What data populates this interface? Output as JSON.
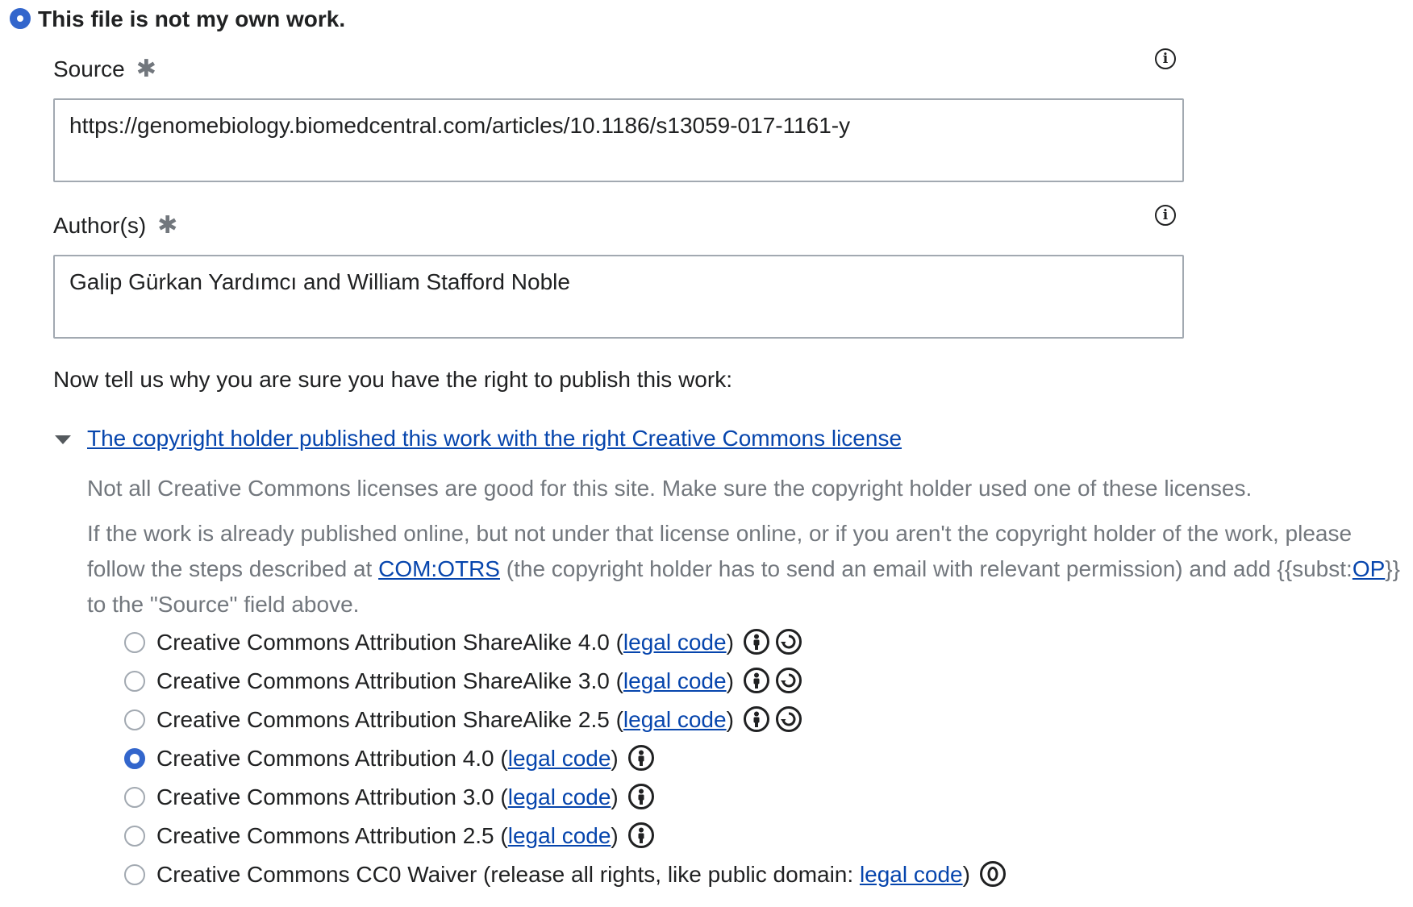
{
  "ownership": {
    "selected_option": "This file is not my own work."
  },
  "source": {
    "label": "Source",
    "required_mark": "✱",
    "value": "https://genomebiology.biomedcentral.com/articles/10.1186/s13059-017-1161-y"
  },
  "authors": {
    "label": "Author(s)",
    "required_mark": "✱",
    "value": "Galip Gürkan Yardımcı and William Stafford Noble"
  },
  "question": "Now tell us why you are sure you have the right to publish this work:",
  "license_section": {
    "expander_label": "The copyright holder published this work with the right Creative Commons license",
    "help_1": "Not all Creative Commons licenses are good for this site. Make sure the copyright holder used one of these licenses.",
    "help_2_before": "If the work is already published online, but not under that license online, or if you aren't the copyright holder of the work, please follow the steps described at ",
    "help_2_link": "COM:OTRS",
    "help_2_middle": " (the copyright holder has to send an email with relevant permission) and add {{subst:",
    "help_2_link2": "OP",
    "help_2_after": "}} to the \"Source\" field above.",
    "legal_code_label": "legal code",
    "licenses": [
      {
        "name": "Creative Commons Attribution ShareAlike 4.0 (",
        "close": ")",
        "icons": [
          "attribution-icon",
          "sharealike-icon"
        ],
        "checked": false
      },
      {
        "name": "Creative Commons Attribution ShareAlike 3.0 (",
        "close": ")",
        "icons": [
          "attribution-icon",
          "sharealike-icon"
        ],
        "checked": false
      },
      {
        "name": "Creative Commons Attribution ShareAlike 2.5 (",
        "close": ")",
        "icons": [
          "attribution-icon",
          "sharealike-icon"
        ],
        "checked": false
      },
      {
        "name": "Creative Commons Attribution 4.0 (",
        "close": ")",
        "icons": [
          "attribution-icon"
        ],
        "checked": true
      },
      {
        "name": "Creative Commons Attribution 3.0 (",
        "close": ")",
        "icons": [
          "attribution-icon"
        ],
        "checked": false
      },
      {
        "name": "Creative Commons Attribution 2.5 (",
        "close": ")",
        "icons": [
          "attribution-icon"
        ],
        "checked": false
      },
      {
        "name": "Creative Commons CC0 Waiver (release all rights, like public domain: ",
        "close": ")",
        "icons": [
          "cc-zero-icon"
        ],
        "checked": false
      }
    ]
  },
  "colors": {
    "accent": "#3366cc",
    "link": "#0645ad",
    "muted_text": "#72777d",
    "border": "#a2a9b1"
  }
}
